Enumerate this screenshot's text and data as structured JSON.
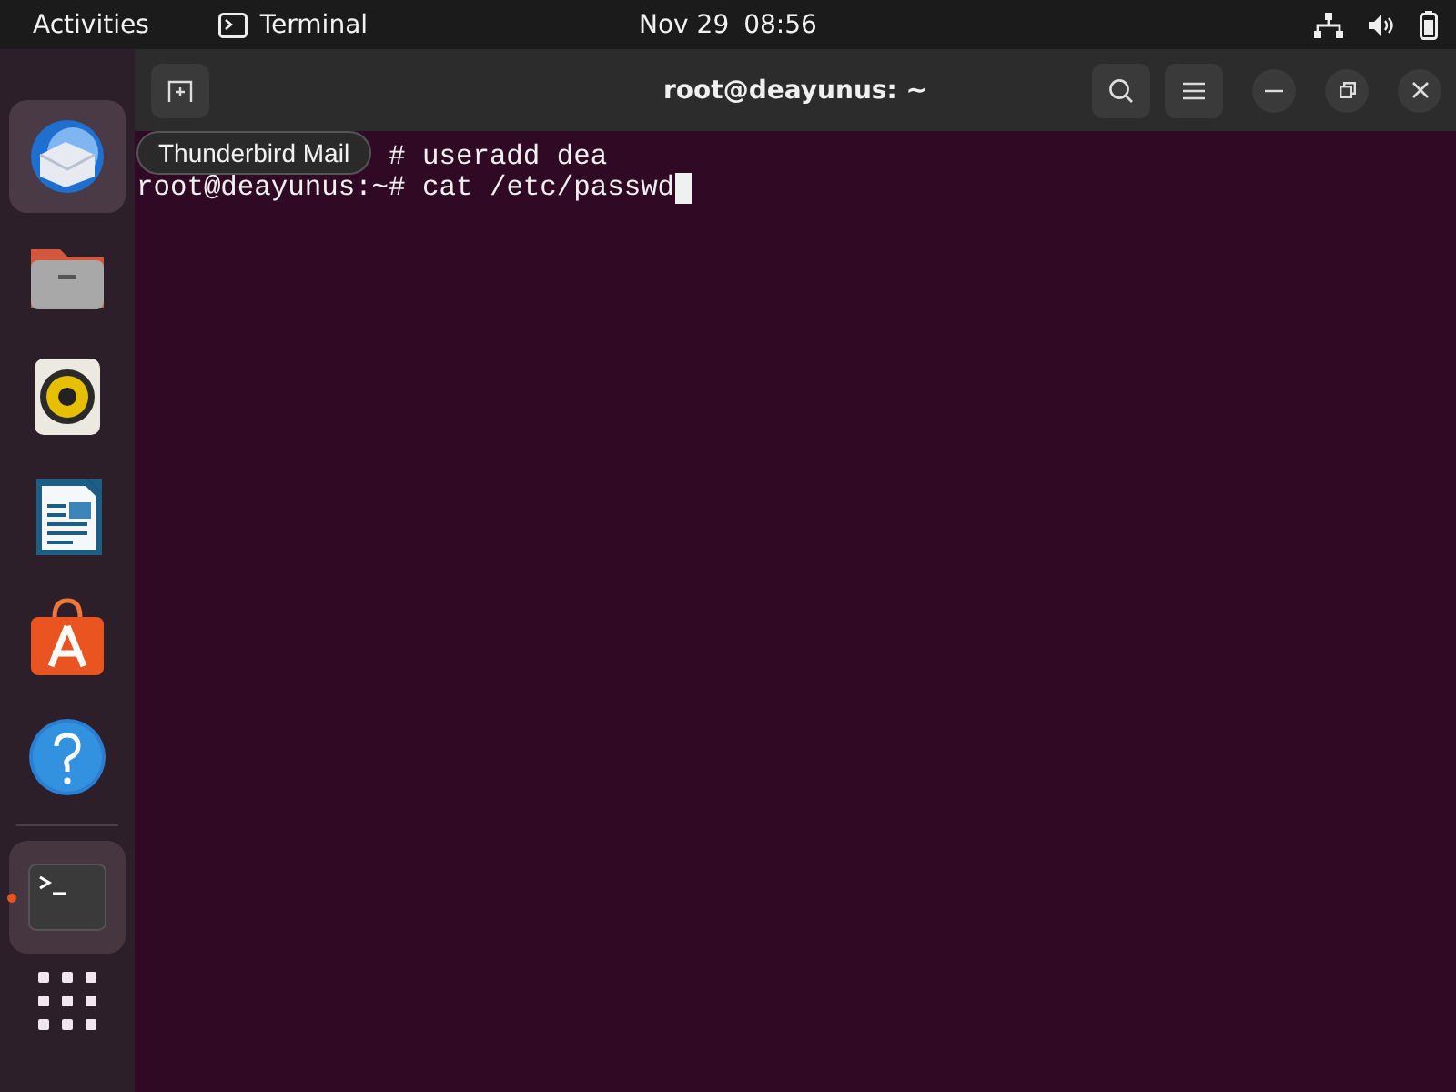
{
  "top_bar": {
    "activities": "Activities",
    "app_name": "Terminal",
    "date": "Nov 29",
    "time": "08:56"
  },
  "dock": {
    "items": [
      {
        "kind": "mail",
        "hovered": true,
        "running": false
      },
      {
        "kind": "files",
        "hovered": false,
        "running": false
      },
      {
        "kind": "music",
        "hovered": false,
        "running": false
      },
      {
        "kind": "writer",
        "hovered": false,
        "running": false
      },
      {
        "kind": "store",
        "hovered": false,
        "running": false
      },
      {
        "kind": "help",
        "hovered": false,
        "running": false
      },
      {
        "kind": "terminal",
        "hovered": false,
        "running": true
      }
    ],
    "tooltip": "Thunderbird Mail"
  },
  "terminal": {
    "title": "root@deayunus: ~",
    "lines": [
      {
        "text": "# useradd dea",
        "hidden_prefix": true
      },
      {
        "text": "root@deayunus:~# cat /etc/passwd",
        "hidden_prefix": false
      }
    ],
    "cursor": true
  }
}
